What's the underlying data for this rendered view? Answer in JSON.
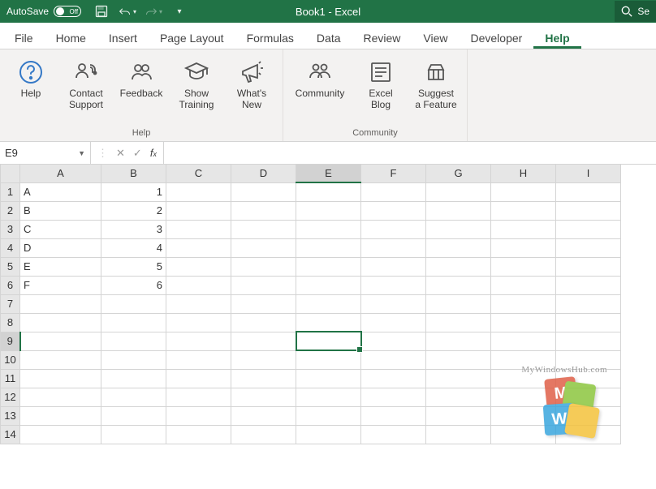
{
  "titlebar": {
    "autosave_label": "AutoSave",
    "autosave_state": "Off",
    "document_title": "Book1  -  Excel",
    "search_placeholder": "Se"
  },
  "tabs": [
    "File",
    "Home",
    "Insert",
    "Page Layout",
    "Formulas",
    "Data",
    "Review",
    "View",
    "Developer",
    "Help"
  ],
  "active_tab": "Help",
  "ribbon": {
    "groups": [
      {
        "name": "Help",
        "buttons": [
          {
            "id": "help",
            "label1": "Help",
            "label2": "",
            "icon": "help-icon"
          },
          {
            "id": "contact-support",
            "label1": "Contact",
            "label2": "Support",
            "icon": "headset-icon"
          },
          {
            "id": "feedback",
            "label1": "Feedback",
            "label2": "",
            "icon": "feedback-icon"
          },
          {
            "id": "show-training",
            "label1": "Show",
            "label2": "Training",
            "icon": "training-icon"
          },
          {
            "id": "whats-new",
            "label1": "What's",
            "label2": "New",
            "icon": "megaphone-icon"
          }
        ]
      },
      {
        "name": "Community",
        "buttons": [
          {
            "id": "community",
            "label1": "Community",
            "label2": "",
            "icon": "community-icon"
          },
          {
            "id": "excel-blog",
            "label1": "Excel",
            "label2": "Blog",
            "icon": "blog-icon"
          },
          {
            "id": "suggest-feature",
            "label1": "Suggest",
            "label2": "a Feature",
            "icon": "suggest-icon"
          }
        ]
      }
    ]
  },
  "formula_bar": {
    "name_box": "E9",
    "formula": ""
  },
  "sheet": {
    "columns": [
      "A",
      "B",
      "C",
      "D",
      "E",
      "F",
      "G",
      "H",
      "I"
    ],
    "rows": 14,
    "selected_cell": "E9",
    "selected_col": "E",
    "selected_row": 9,
    "cells": {
      "A1": "A",
      "B1": "1",
      "A2": "B",
      "B2": "2",
      "A3": "C",
      "B3": "3",
      "A4": "D",
      "B4": "4",
      "A5": "E",
      "B5": "5",
      "A6": "F",
      "B6": "6"
    }
  },
  "watermark": "MyWindowsHub.com"
}
